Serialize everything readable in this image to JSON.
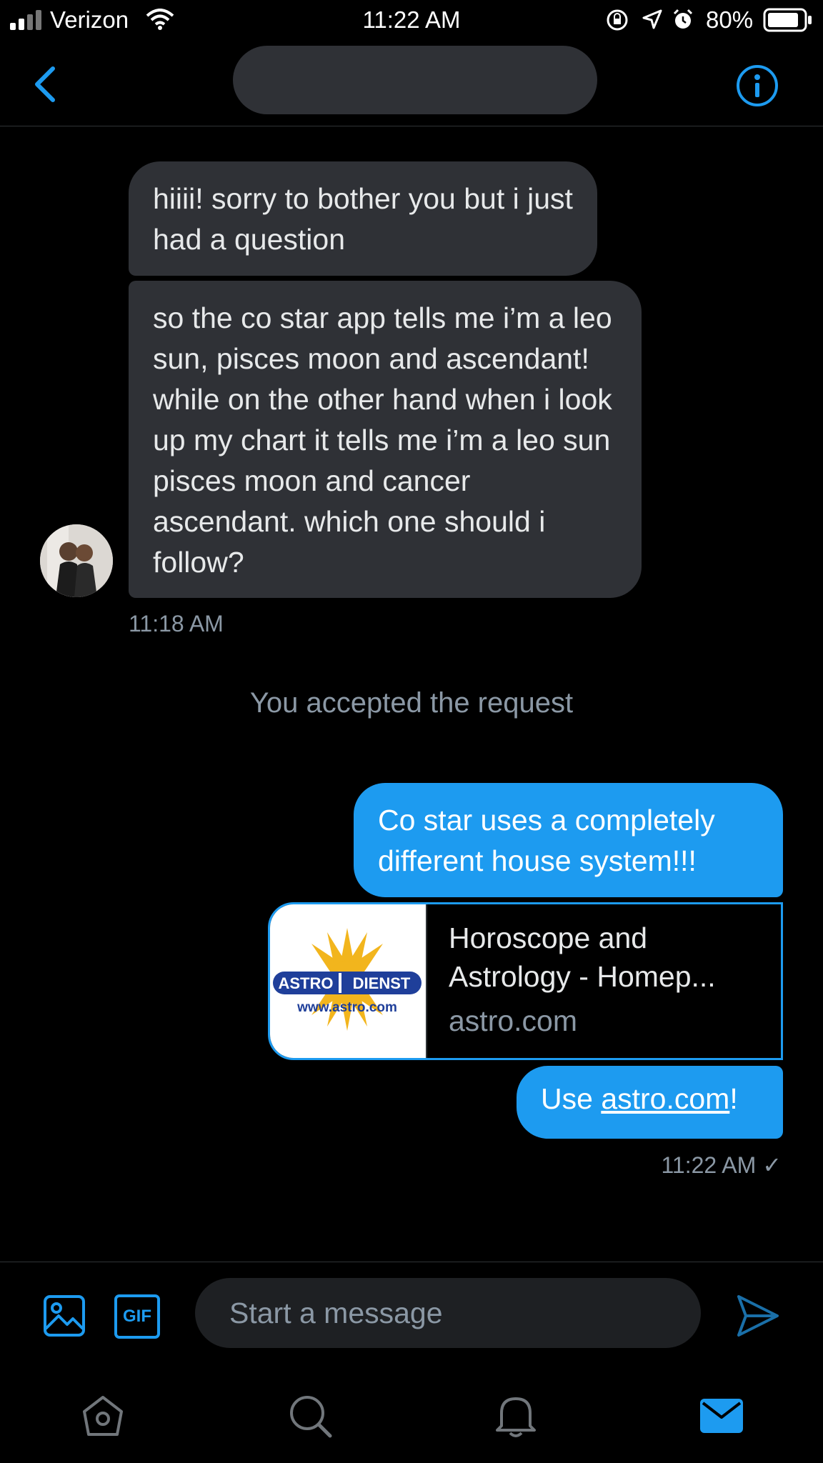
{
  "status_bar": {
    "carrier": "Verizon",
    "time": "11:22 AM",
    "battery": "80%"
  },
  "header": {
    "back_icon": "chevron-left-icon",
    "info_icon": "info-circle-icon",
    "colors": {
      "accent": "#1d9bf0"
    }
  },
  "messages": {
    "incoming": [
      {
        "text": "hiiii! sorry to bother you but i just had a question"
      },
      {
        "text": "so the co star app tells me i’m a leo sun, pisces moon and ascendant! while on the other hand when i look up my chart it tells me i’m a leo sun pisces moon and cancer ascendant. which one should i follow?"
      }
    ],
    "incoming_time": "11:18 AM",
    "system_note": "You accepted the request",
    "outgoing": {
      "first": "Co star uses a completely different house system!!!",
      "card": {
        "title": "Horoscope and Astrology - Homep...",
        "domain": "astro.com",
        "logo_left": "ASTRO",
        "logo_right": "DIENST",
        "logo_url": "www.astro.com"
      },
      "last_prefix": "Use ",
      "last_link": "astro.com",
      "last_suffix": "!",
      "time": "11:22 AM ✓"
    }
  },
  "compose": {
    "placeholder": "Start a message",
    "gif_label": "GIF",
    "icons": [
      "image-icon",
      "gif-icon",
      "send-icon"
    ]
  },
  "tabbar": {
    "icons": [
      "home-icon",
      "search-icon",
      "notifications-icon",
      "messages-icon"
    ]
  }
}
